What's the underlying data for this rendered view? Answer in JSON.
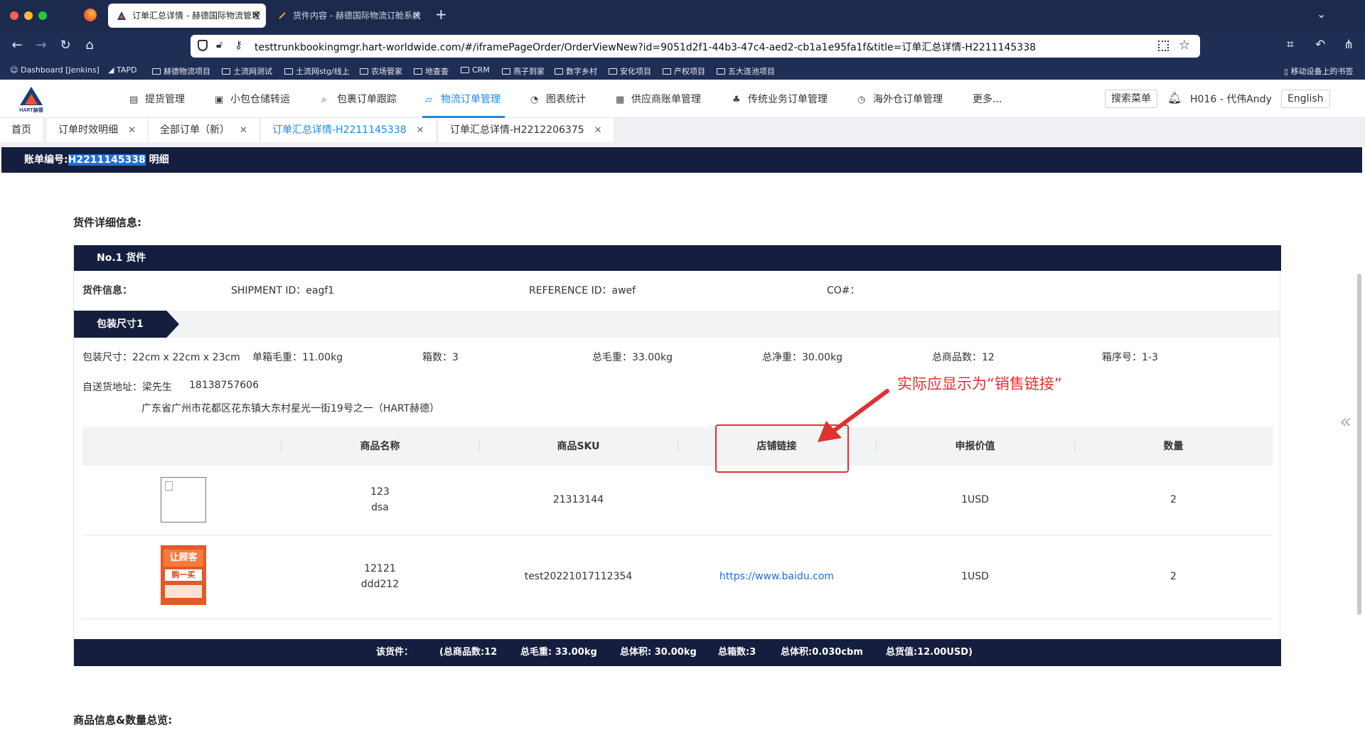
{
  "browser": {
    "active_tab_title": "订单汇总详情 - 赫德国际物流管理",
    "inactive_tab_title": "货件内容 - 赫德国际物流订舱系统",
    "url": "testtrunkbookingmgr.hart-worldwide.com/#/iframePageOrder/OrderViewNew?id=9051d2f1-44b3-47c4-aed2-cb1a1e95fa1f&title=订单汇总详情-H2211145338",
    "bookmarks": [
      "Dashboard [Jenkins]",
      "TAPD",
      "赫德物流项目",
      "土流网测试",
      "土流网stg/线上",
      "农场管家",
      "地查查",
      "CRM",
      "燕子到家",
      "数字乡村",
      "安化项目",
      "产权项目",
      "五大连池项目"
    ],
    "mobile_bookmarks": "移动设备上的书签"
  },
  "header": {
    "menu": [
      "提货管理",
      "小包仓储转运",
      "包裹订单跟踪",
      "物流订单管理",
      "图表统计",
      "供应商账单管理",
      "传统业务订单管理",
      "海外仓订单管理",
      "更多..."
    ],
    "active_menu": "物流订单管理",
    "search_menu": "搜索菜单",
    "user": "H016 - 代伟Andy",
    "language": "English",
    "logo_text": "HART赫德"
  },
  "page_tabs": [
    "首页",
    "订单时效明细",
    "全部订单（新）",
    "订单汇总详情-H2211145338",
    "订单汇总详情-H2212206375"
  ],
  "bill": {
    "prefix": "账单编号:",
    "number": "H2211145338",
    "suffix": " 明细"
  },
  "section_detail_title": "货件详细信息:",
  "shipment": {
    "header": "No.1 货件",
    "info_label": "货件信息：",
    "shipment_id": "SHIPMENT ID：eagf1",
    "reference_id": "REFERENCE ID：awef",
    "co": "CO#："
  },
  "package": {
    "tag": "包装尺寸1",
    "size": "包装尺寸：22cm x 22cm x 23cm",
    "unit_weight": "单箱毛重：11.00kg",
    "box_count": "箱数：3",
    "gross_weight": "总毛重：33.00kg",
    "net_weight": "总净重：30.00kg",
    "total_items": "总商品数：12",
    "box_numbers": "箱序号：1-3",
    "address_label": "自送货地址：梁先生",
    "phone": "18138757606",
    "address": "广东省广州市花都区花东镇大东村星光一街19号之一（HART赫德）"
  },
  "table": {
    "headers": [
      "商品名称",
      "商品SKU",
      "店铺链接",
      "申报价值",
      "数量"
    ],
    "rows": [
      {
        "name_line1": "123",
        "name_line2": "dsa",
        "sku": "21313144",
        "link": "",
        "value": "1USD",
        "qty": "2"
      },
      {
        "name_line1": "12121",
        "name_line2": "ddd212",
        "sku": "test20221017112354",
        "link": "https://www.baidu.com",
        "value": "1USD",
        "qty": "2"
      }
    ],
    "thumb_text_1": "让顾客",
    "thumb_text_2": "购一买"
  },
  "summary": {
    "label": "该货件：",
    "items": "(总商品数:12",
    "gross": "总毛重: 33.00kg",
    "volume_weight": "总体积: 30.00kg",
    "boxes": "总箱数:3",
    "volume": "总体积:0.030cbm",
    "value": "总货值:12.00USD)"
  },
  "annotation": "实际应显示为“销售链接”",
  "section_overview_title": "商品信息&数量总览:",
  "colors": {
    "dark_bar": "#151e3f",
    "accent": "#1e88e5",
    "annotation": "#e03131"
  }
}
